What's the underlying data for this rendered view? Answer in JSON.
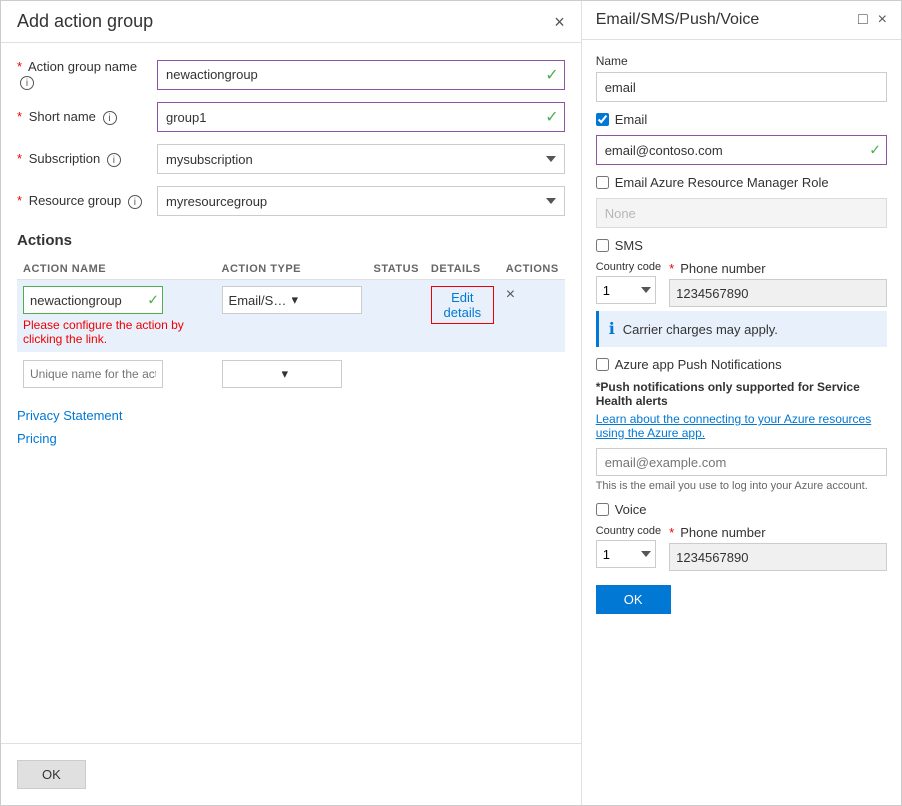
{
  "leftPanel": {
    "title": "Add action group",
    "closeLabel": "×",
    "form": {
      "actionGroupName": {
        "label": "Action group name",
        "value": "newactiongroup",
        "required": true
      },
      "shortName": {
        "label": "Short name",
        "value": "group1",
        "required": true
      },
      "subscription": {
        "label": "Subscription",
        "value": "mysubscription",
        "required": true
      },
      "resourceGroup": {
        "label": "Resource group",
        "value": "myresourcegroup",
        "required": true
      }
    },
    "actionsSection": {
      "title": "Actions",
      "columns": [
        "ACTION NAME",
        "ACTION TYPE",
        "STATUS",
        "DETAILS",
        "ACTIONS"
      ],
      "rows": [
        {
          "name": "newactiongroup",
          "type": "Email/SMS/Push/V...",
          "status": "",
          "details": "Edit details",
          "error": "Please configure the action by clicking the link."
        }
      ],
      "newRowPlaceholder": "Unique name for the act..."
    },
    "privacyStatement": "Privacy Statement",
    "pricing": "Pricing",
    "footer": {
      "okLabel": "OK"
    }
  },
  "rightPanel": {
    "title": "Email/SMS/Push/Voice",
    "minimizeLabel": "□",
    "closeLabel": "×",
    "nameField": {
      "label": "Name",
      "value": "email"
    },
    "emailSection": {
      "checkboxLabel": "Email",
      "checked": true,
      "emailValue": "email@contoso.com",
      "emailPlaceholder": "email@contoso.com"
    },
    "emailAzureRole": {
      "checkboxLabel": "Email Azure Resource Manager Role",
      "checked": false,
      "selectValue": "None"
    },
    "smsSection": {
      "checkboxLabel": "SMS",
      "checked": false,
      "countryCodeLabel": "Country code",
      "countryCodeValue": "1",
      "phoneLabel": "Phone number",
      "phoneValue": "1234567890",
      "bannerText": "Carrier charges may apply."
    },
    "pushSection": {
      "checkboxLabel": "Azure app Push Notifications",
      "checked": false,
      "noteText": "*Push notifications only supported for Service Health alerts",
      "linkText": "Learn about the connecting to your Azure resources using the Azure app.",
      "emailPlaceholder": "email@example.com",
      "accountNote": "This is the email you use to log into your Azure account."
    },
    "voiceSection": {
      "checkboxLabel": "Voice",
      "checked": false,
      "countryCodeLabel": "Country code",
      "countryCodeValue": "1",
      "phoneLabel": "Phone number",
      "phoneValue": "1234567890"
    },
    "okLabel": "OK"
  }
}
